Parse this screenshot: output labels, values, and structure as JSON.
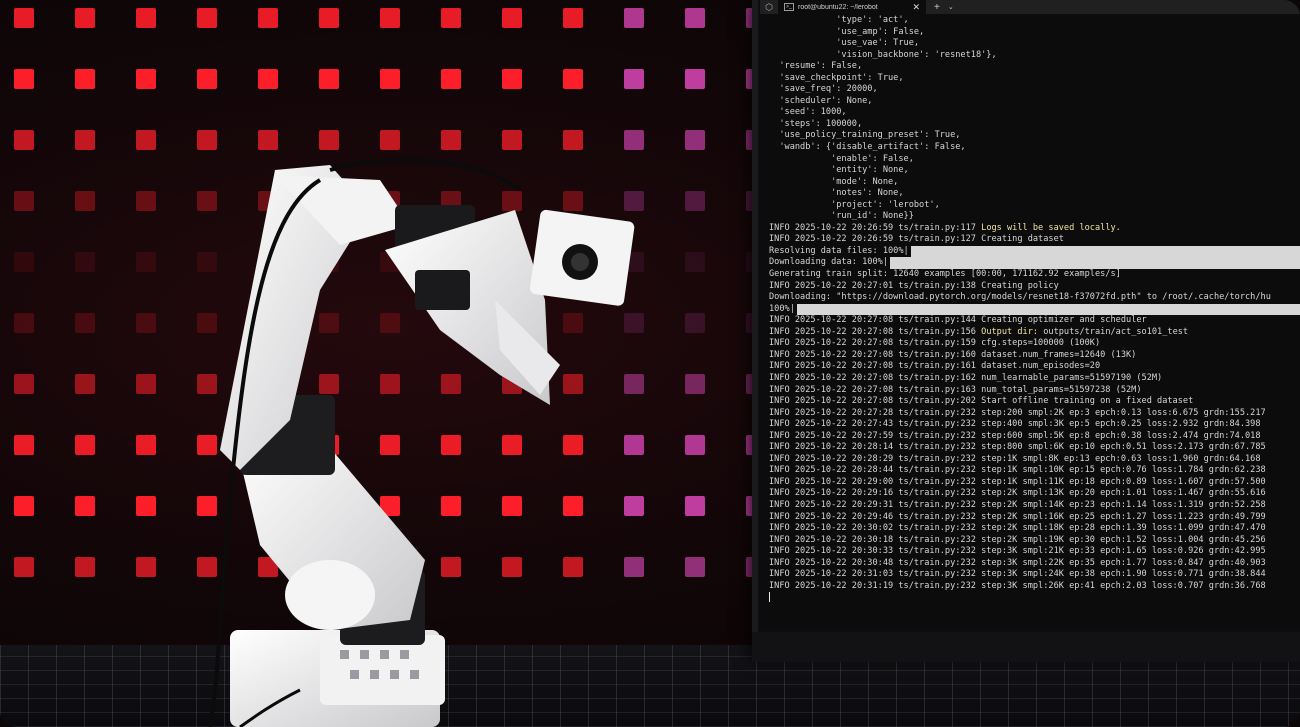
{
  "terminal": {
    "tab_title": "root@ubuntu22: ~/lerobot",
    "tab_close": "✕",
    "new_tab": "+",
    "dropdown": "⌄",
    "lines": [
      "             'type': 'act',",
      "             'use_amp': False,",
      "             'use_vae': True,",
      "             'vision_backbone': 'resnet18'},",
      "  'resume': False,",
      "  'save_checkpoint': True,",
      "  'save_freq': 20000,",
      "  'scheduler': None,",
      "  'seed': 1000,",
      "  'steps': 100000,",
      "  'use_policy_training_preset': True,",
      "  'wandb': {'disable_artifact': False,",
      "            'enable': False,",
      "            'entity': None,",
      "            'mode': None,",
      "            'notes': None,",
      "            'project': 'lerobot',",
      "            'run_id': None}}",
      "INFO 2025-10-22 20:26:59 ts/train.py:117 Logs will be saved locally.",
      "INFO 2025-10-22 20:26:59 ts/train.py:127 Creating dataset",
      "Resolving data files: 100%|",
      "Downloading data: 100%|",
      "Generating train split: 12640 examples [00:00, 171162.92 examples/s]",
      "INFO 2025-10-22 20:27:01 ts/train.py:138 Creating policy",
      "Downloading: \"https://download.pytorch.org/models/resnet18-f37072fd.pth\" to /root/.cache/torch/hu",
      "100%|",
      "INFO 2025-10-22 20:27:08 ts/train.py:144 Creating optimizer and scheduler",
      "INFO 2025-10-22 20:27:08 ts/train.py:156 Output dir: outputs/train/act_so101_test",
      "INFO 2025-10-22 20:27:08 ts/train.py:159 cfg.steps=100000 (100K)",
      "INFO 2025-10-22 20:27:08 ts/train.py:160 dataset.num_frames=12640 (13K)",
      "INFO 2025-10-22 20:27:08 ts/train.py:161 dataset.num_episodes=20",
      "INFO 2025-10-22 20:27:08 ts/train.py:162 num_learnable_params=51597190 (52M)",
      "INFO 2025-10-22 20:27:08 ts/train.py:163 num_total_params=51597238 (52M)",
      "INFO 2025-10-22 20:27:08 ts/train.py:202 Start offline training on a fixed dataset",
      "INFO 2025-10-22 20:27:28 ts/train.py:232 step:200 smpl:2K ep:3 epch:0.13 loss:6.675 grdn:155.217",
      "INFO 2025-10-22 20:27:43 ts/train.py:232 step:400 smpl:3K ep:5 epch:0.25 loss:2.932 grdn:84.398",
      "INFO 2025-10-22 20:27:59 ts/train.py:232 step:600 smpl:5K ep:8 epch:0.38 loss:2.474 grdn:74.018",
      "INFO 2025-10-22 20:28:14 ts/train.py:232 step:800 smpl:6K ep:10 epch:0.51 loss:2.173 grdn:67.785",
      "INFO 2025-10-22 20:28:29 ts/train.py:232 step:1K smpl:8K ep:13 epch:0.63 loss:1.960 grdn:64.168",
      "INFO 2025-10-22 20:28:44 ts/train.py:232 step:1K smpl:10K ep:15 epch:0.76 loss:1.784 grdn:62.238",
      "INFO 2025-10-22 20:29:00 ts/train.py:232 step:1K smpl:11K ep:18 epch:0.89 loss:1.607 grdn:57.500",
      "INFO 2025-10-22 20:29:16 ts/train.py:232 step:2K smpl:13K ep:20 epch:1.01 loss:1.467 grdn:55.616",
      "INFO 2025-10-22 20:29:31 ts/train.py:232 step:2K smpl:14K ep:23 epch:1.14 loss:1.319 grdn:52.258",
      "INFO 2025-10-22 20:29:46 ts/train.py:232 step:2K smpl:16K ep:25 epch:1.27 loss:1.223 grdn:49.799",
      "INFO 2025-10-22 20:30:02 ts/train.py:232 step:2K smpl:18K ep:28 epch:1.39 loss:1.099 grdn:47.470",
      "INFO 2025-10-22 20:30:18 ts/train.py:232 step:2K smpl:19K ep:30 epch:1.52 loss:1.004 grdn:45.256",
      "INFO 2025-10-22 20:30:33 ts/train.py:232 step:3K smpl:21K ep:33 epch:1.65 loss:0.926 grdn:42.995",
      "INFO 2025-10-22 20:30:48 ts/train.py:232 step:3K smpl:22K ep:35 epch:1.77 loss:0.847 grdn:40.903",
      "INFO 2025-10-22 20:31:03 ts/train.py:232 step:3K smpl:24K ep:38 epch:1.90 loss:0.771 grdn:38.844",
      "INFO 2025-10-22 20:31:19 ts/train.py:232 step:3K smpl:26K ep:41 epch:2.03 loss:0.707 grdn:36.768"
    ],
    "progress_bar_lines": [
      20,
      21,
      25
    ],
    "highlight_phrases": [
      "Logs will be saved locally.",
      "Output dir:"
    ]
  },
  "colors": {
    "led": "#ff1f2a",
    "led_right": "#c03ea0",
    "terminal_bg": "#0c0c0c",
    "terminal_text": "#d6d6d6",
    "highlight": "#f0e4a0"
  }
}
